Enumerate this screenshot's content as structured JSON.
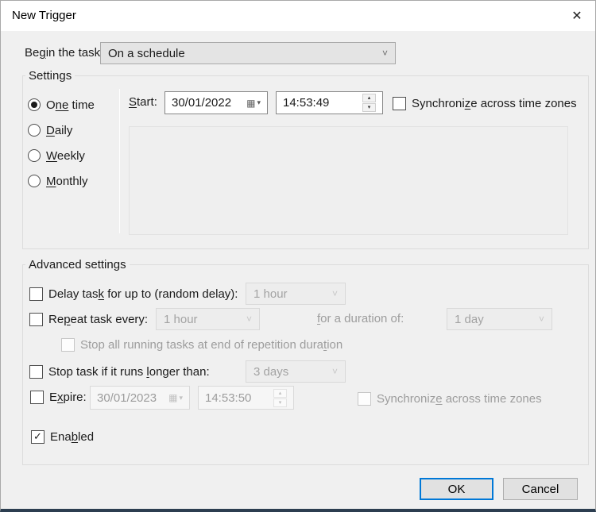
{
  "window": {
    "title": "New Trigger"
  },
  "icons": {
    "close": "✕",
    "chevron": "˅",
    "calendar": "▦",
    "drop_arrow": "▾",
    "spin_up": "▴",
    "spin_down": "▾",
    "check": "✓"
  },
  "colors": {
    "accent": "#0078d7",
    "body_bg": "#f0f0f0",
    "titlebar_bg": "#ffffff",
    "disabled_text": "#9d9d9d",
    "window_bottom_edge": "#2c3e50"
  },
  "begin_task": {
    "label": {
      "pre": "Be",
      "key": "g",
      "post": "in the task:"
    },
    "value": "On a schedule"
  },
  "settings": {
    "group_label": "Settings",
    "radios": [
      {
        "pre": "O",
        "key": "ne",
        "post": " time",
        "selected": true
      },
      {
        "pre": "",
        "key": "D",
        "post": "aily",
        "selected": false
      },
      {
        "pre": "",
        "key": "W",
        "post": "eekly",
        "selected": false
      },
      {
        "pre": "",
        "key": "M",
        "post": "onthly",
        "selected": false
      }
    ],
    "start": {
      "label": {
        "pre": "",
        "key": "S",
        "post": "tart:"
      },
      "date": "30/01/2022",
      "time": "14:53:49"
    },
    "sync": {
      "pre": "Synchroni",
      "key": "z",
      "post": "e across time zones",
      "checked": false
    }
  },
  "advanced": {
    "group_label": "Advanced settings",
    "delay": {
      "label": {
        "pre": "Delay tas",
        "key": "k",
        "post": " for up to (random delay):"
      },
      "value": "1 hour",
      "checked": false
    },
    "repeat": {
      "label": {
        "pre": "Re",
        "key": "p",
        "post": "eat task every:"
      },
      "value": "1 hour",
      "checked": false
    },
    "duration": {
      "label": {
        "pre": "",
        "key": "f",
        "post": "or a duration of:"
      },
      "value": "1 day"
    },
    "stop_all": {
      "label": {
        "pre": "Stop all running tasks at end of repetition dura",
        "key": "t",
        "post": "ion"
      },
      "checked": false
    },
    "stop_task": {
      "label": {
        "pre": "Stop task if it runs ",
        "key": "l",
        "post": "onger than:"
      },
      "value": "3 days",
      "checked": false
    },
    "expire": {
      "label": {
        "pre": "E",
        "key": "x",
        "post": "pire:"
      },
      "date": "30/01/2023",
      "time": "14:53:50",
      "checked": false
    },
    "expire_sync": {
      "pre": "Synchroniz",
      "key": "e",
      "post": " across time zones",
      "checked": false
    },
    "enabled": {
      "label": {
        "pre": "Ena",
        "key": "b",
        "post": "led"
      },
      "checked": true
    }
  },
  "footer": {
    "ok": "OK",
    "cancel": "Cancel"
  }
}
